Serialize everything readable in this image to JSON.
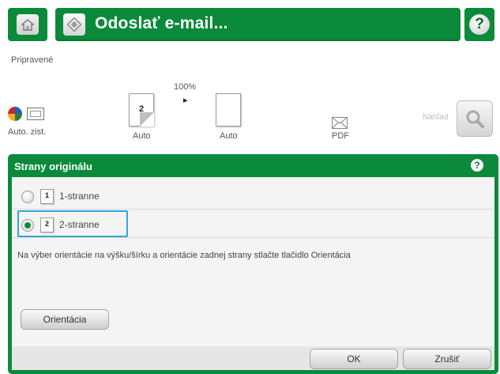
{
  "header": {
    "title": "Odoslať e-mail...",
    "help_glyph": "?"
  },
  "status": {
    "text": "Pripravené"
  },
  "toolbar": {
    "auto_store_label": "Auto. zist.",
    "sides_label": "Auto",
    "sides_page_number": "2",
    "zoom_value": "100%",
    "zoom_arrow": "▸",
    "size_label": "Auto",
    "format_label": "PDF",
    "preview_label": "Náhľad"
  },
  "dialog": {
    "title": "Strany originálu",
    "help_glyph": "?",
    "options": [
      {
        "icon_number": "1",
        "label": "1-stranne",
        "selected": false
      },
      {
        "icon_number": "2",
        "label": "2-stranne",
        "selected": true
      }
    ],
    "hint": "Na výber orientácie na výšku/šírku a orientácie zadnej strany stlačte tlačidlo Orientácia",
    "orientation_button": "Orientácia",
    "ok_button": "OK",
    "cancel_button": "Zrušiť"
  },
  "colors": {
    "brand_green": "#0a8a3a",
    "selection_blue": "#33a5e0"
  },
  "icons": [
    "home-icon",
    "email-icon",
    "help-icon",
    "color-sphere-icon",
    "scanner-icon",
    "page-icon",
    "pdf-envelope-icon",
    "magnifier-icon",
    "radio-icon"
  ]
}
